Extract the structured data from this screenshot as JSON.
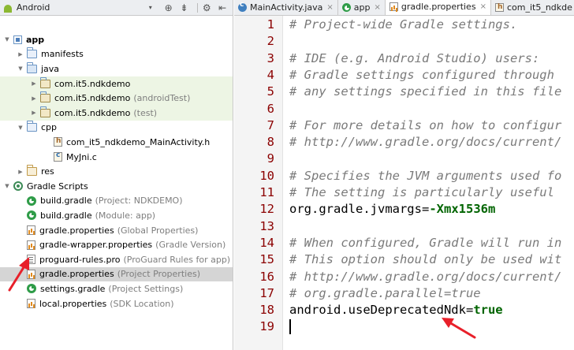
{
  "project_panel": {
    "view": "Android",
    "toolbar_icons": [
      "sync-icon",
      "collapse-all-icon",
      "gear-icon",
      "hide-icon"
    ],
    "tree": [
      {
        "name": "app",
        "suffix": "",
        "icon": "module-icon",
        "depth": 0,
        "arrow": "down",
        "bold": true
      },
      {
        "name": "manifests",
        "suffix": "",
        "icon": "folder-icon",
        "depth": 1,
        "arrow": "right"
      },
      {
        "name": "java",
        "suffix": "",
        "icon": "java-folder-icon",
        "depth": 1,
        "arrow": "down"
      },
      {
        "name": "com.it5.ndkdemo",
        "suffix": "",
        "icon": "package-icon",
        "depth": 2,
        "arrow": "right"
      },
      {
        "name": "com.it5.ndkdemo",
        "suffix": "(androidTest)",
        "icon": "package-icon",
        "depth": 2,
        "arrow": "right"
      },
      {
        "name": "com.it5.ndkdemo",
        "suffix": "(test)",
        "icon": "package-icon",
        "depth": 2,
        "arrow": "right"
      },
      {
        "name": "cpp",
        "suffix": "",
        "icon": "cpp-folder-icon",
        "depth": 1,
        "arrow": "down"
      },
      {
        "name": "com_it5_ndkdemo_MainActivity.h",
        "suffix": "",
        "icon": "header-file-icon",
        "depth": 3,
        "arrow": ""
      },
      {
        "name": "MyJni.c",
        "suffix": "",
        "icon": "c-file-icon",
        "depth": 3,
        "arrow": ""
      },
      {
        "name": "res",
        "suffix": "",
        "icon": "res-folder-icon",
        "depth": 1,
        "arrow": "right"
      },
      {
        "name": "Gradle Scripts",
        "suffix": "",
        "icon": "gradle-scripts-icon",
        "depth": 0,
        "arrow": "down"
      },
      {
        "name": "build.gradle",
        "suffix": "(Project: NDKDEMO)",
        "icon": "gradle-file-icon",
        "depth": 1,
        "arrow": ""
      },
      {
        "name": "build.gradle",
        "suffix": "(Module: app)",
        "icon": "gradle-file-icon",
        "depth": 1,
        "arrow": ""
      },
      {
        "name": "gradle.properties",
        "suffix": "(Global Properties)",
        "icon": "properties-file-icon",
        "depth": 1,
        "arrow": ""
      },
      {
        "name": "gradle-wrapper.properties",
        "suffix": "(Gradle Version)",
        "icon": "properties-file-icon",
        "depth": 1,
        "arrow": ""
      },
      {
        "name": "proguard-rules.pro",
        "suffix": "(ProGuard Rules for app)",
        "icon": "pro-file-icon",
        "depth": 1,
        "arrow": ""
      },
      {
        "name": "gradle.properties",
        "suffix": "(Project Properties)",
        "icon": "properties-file-icon",
        "depth": 1,
        "arrow": "",
        "selected": true
      },
      {
        "name": "settings.gradle",
        "suffix": "(Project Settings)",
        "icon": "gradle-file-icon",
        "depth": 1,
        "arrow": ""
      },
      {
        "name": "local.properties",
        "suffix": "(SDK Location)",
        "icon": "properties-file-icon",
        "depth": 1,
        "arrow": ""
      }
    ]
  },
  "editor": {
    "tabs": [
      {
        "label": "MainActivity.java",
        "icon": "java-class-icon",
        "active": false
      },
      {
        "label": "app",
        "icon": "gradle-file-icon",
        "active": false
      },
      {
        "label": "gradle.properties",
        "icon": "properties-file-icon",
        "active": true
      },
      {
        "label": "com_it5_ndkde",
        "icon": "header-file-icon",
        "active": false
      }
    ],
    "close_glyph": "×",
    "lines": [
      {
        "n": "1",
        "type": "comment",
        "text": "# Project-wide Gradle settings."
      },
      {
        "n": "2",
        "type": "blank",
        "text": ""
      },
      {
        "n": "3",
        "type": "comment",
        "text": "# IDE (e.g. Android Studio) users:"
      },
      {
        "n": "4",
        "type": "comment",
        "text": "# Gradle settings configured through"
      },
      {
        "n": "5",
        "type": "comment",
        "text": "# any settings specified in this file"
      },
      {
        "n": "6",
        "type": "blank",
        "text": ""
      },
      {
        "n": "7",
        "type": "comment",
        "text": "# For more details on how to configur"
      },
      {
        "n": "8",
        "type": "comment",
        "text": "# http://www.gradle.org/docs/current/"
      },
      {
        "n": "9",
        "type": "blank",
        "text": ""
      },
      {
        "n": "10",
        "type": "comment",
        "text": "# Specifies the JVM arguments used fo"
      },
      {
        "n": "11",
        "type": "comment",
        "text": "# The setting is particularly useful"
      },
      {
        "n": "12",
        "type": "property",
        "key": "org.gradle.jvmargs",
        "value": "-Xmx1536m"
      },
      {
        "n": "13",
        "type": "blank",
        "text": ""
      },
      {
        "n": "14",
        "type": "comment",
        "text": "# When configured, Gradle will run in"
      },
      {
        "n": "15",
        "type": "comment",
        "text": "# This option should only be used wit"
      },
      {
        "n": "16",
        "type": "comment",
        "text": "# http://www.gradle.org/docs/current/"
      },
      {
        "n": "17",
        "type": "comment",
        "text": "# org.gradle.parallel=true"
      },
      {
        "n": "18",
        "type": "property",
        "key": "android.useDeprecatedNdk",
        "value": "true"
      },
      {
        "n": "19",
        "type": "blank",
        "text": ""
      }
    ]
  },
  "annotation_color": "#e8202a"
}
